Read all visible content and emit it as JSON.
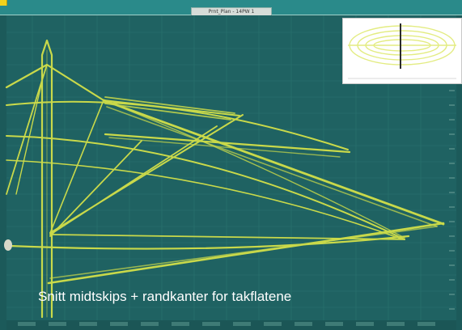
{
  "window": {
    "title": "Prnt_Plan - 14PW 1"
  },
  "caption": {
    "text": "Snitt midtskips + randkanter for takflatene"
  },
  "preview": {
    "label": "",
    "colors": {
      "background": "#ffffff",
      "shape": "#e6ee8a",
      "axis": "#2b2b2b"
    }
  },
  "colors": {
    "background": "#1f6262",
    "grid": "#2f7a74",
    "lines": "#c9d94a",
    "titlebar": "#2a8a8a"
  },
  "icons": {
    "app": "app-icon",
    "handle": "drag-handle-icon"
  }
}
